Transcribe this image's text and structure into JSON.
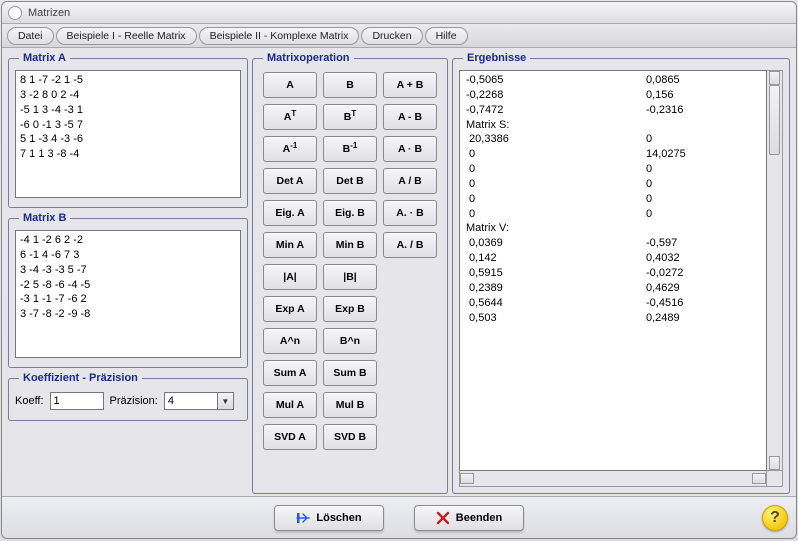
{
  "window": {
    "title": "Matrizen"
  },
  "menu": [
    "Datei",
    "Beispiele I - Reelle Matrix",
    "Beispiele II - Komplexe Matrix",
    "Drucken",
    "Hilfe"
  ],
  "matrixA": {
    "legend": "Matrix A",
    "text": "8 1 -7 -2 1 -5\n3 -2 8 0 2 -4\n-5 1 3 -4 -3 1\n-6 0 -1 3 -5 7\n5 1 -3 4 -3 -6\n7 1 1 3 -8 -4"
  },
  "matrixB": {
    "legend": "Matrix B",
    "text": "-4 1 -2 6 2 -2\n6 -1 4 -6 7 3\n3 -4 -3 -3 5 -7\n-2 5 -8 -6 -4 -5\n-3 1 -1 -7 -6 2\n3 -7 -8 -2 -9 -8"
  },
  "koeff": {
    "legend": "Koeffizient - Präzision",
    "koeff_label": "Koeff:",
    "koeff_value": "1",
    "praez_label": "Präzision:",
    "praez_value": "4"
  },
  "ops": {
    "legend": "Matrixoperation",
    "buttons": [
      [
        "A",
        "B",
        "A + B"
      ],
      [
        "A<sup>T</sup>",
        "B<sup>T</sup>",
        "A - B"
      ],
      [
        "A<sup>-1</sup>",
        "B<sup>-1</sup>",
        "A · B"
      ],
      [
        "Det A",
        "Det B",
        "A / B"
      ],
      [
        "Eig. A",
        "Eig. B",
        "A. · B"
      ],
      [
        "Min A",
        "Min B",
        "A. / B"
      ],
      [
        "|A|",
        "|B|",
        ""
      ],
      [
        "Exp A",
        "Exp B",
        ""
      ],
      [
        "A^n",
        "B^n",
        ""
      ],
      [
        "Sum A",
        "Sum B",
        ""
      ],
      [
        "Mul A",
        "Mul B",
        ""
      ],
      [
        "SVD A",
        "SVD B",
        ""
      ]
    ]
  },
  "results": {
    "legend": "Ergebnisse",
    "rows": [
      {
        "c1": "-0,5065",
        "c2": "0,0865"
      },
      {
        "c1": "-0,2268",
        "c2": "0,156"
      },
      {
        "c1": "-0,7472",
        "c2": "-0,2316"
      },
      {
        "c1": "",
        "c2": ""
      },
      {
        "c1": "Matrix S:",
        "c2": ""
      },
      {
        "c1": "",
        "c2": ""
      },
      {
        "c1": " 20,3386",
        "c2": "0"
      },
      {
        "c1": " 0",
        "c2": "14,0275"
      },
      {
        "c1": " 0",
        "c2": "0"
      },
      {
        "c1": " 0",
        "c2": "0"
      },
      {
        "c1": " 0",
        "c2": "0"
      },
      {
        "c1": " 0",
        "c2": "0"
      },
      {
        "c1": "",
        "c2": ""
      },
      {
        "c1": "Matrix V:",
        "c2": ""
      },
      {
        "c1": "",
        "c2": ""
      },
      {
        "c1": " 0,0369",
        "c2": "-0,597"
      },
      {
        "c1": " 0,142",
        "c2": "0,4032"
      },
      {
        "c1": " 0,5915",
        "c2": "-0,0272"
      },
      {
        "c1": " 0,2389",
        "c2": "0,4629"
      },
      {
        "c1": " 0,5644",
        "c2": "-0,4516"
      },
      {
        "c1": " 0,503",
        "c2": "0,2489"
      }
    ]
  },
  "actions": {
    "clear": "Löschen",
    "exit": "Beenden"
  },
  "help_glyph": "?"
}
